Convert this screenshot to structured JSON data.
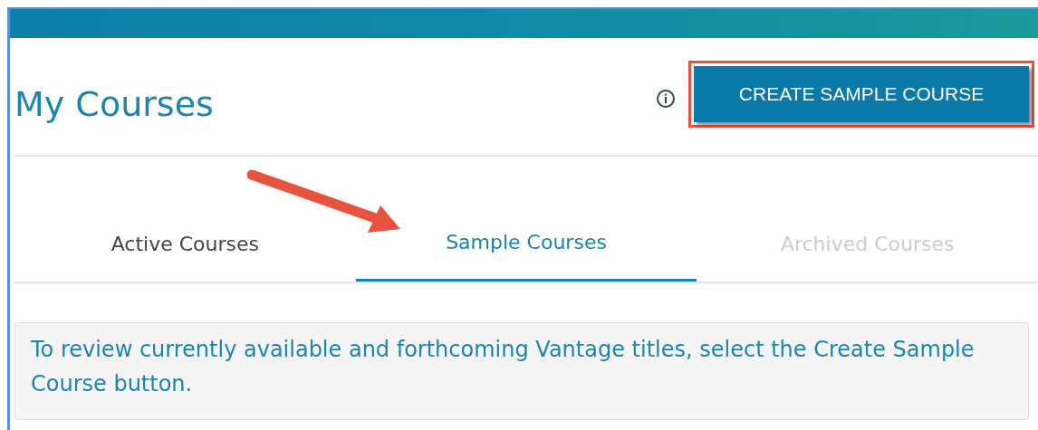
{
  "page": {
    "title": "My Courses"
  },
  "create_button": {
    "label": "CREATE SAMPLE COURSE",
    "highlighted": true
  },
  "tabs": [
    {
      "label": "Active Courses",
      "selected": false,
      "disabled": false
    },
    {
      "label": "Sample Courses",
      "selected": true,
      "disabled": false
    },
    {
      "label": "Archived Courses",
      "selected": false,
      "disabled": true
    }
  ],
  "notice": {
    "text": "To review currently available and forthcoming Vantage titles, select the Create Sample Course button."
  }
}
